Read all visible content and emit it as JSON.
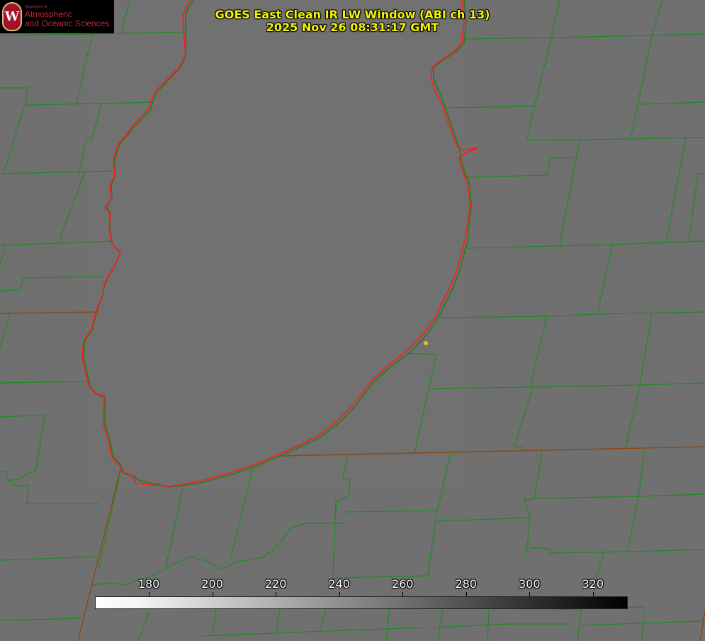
{
  "logo": {
    "department": "Department of",
    "line1": "Atmospheric",
    "line2": "and Oceanic Sciences",
    "seal_letter": "W"
  },
  "header": {
    "title_line1": "GOES East Clean IR LW Window (ABI ch 13)",
    "title_line2": "2025 Nov 26 08:31:17 GMT"
  },
  "colorbar": {
    "ticks": [
      "180",
      "200",
      "220",
      "240",
      "260",
      "280",
      "300",
      "320"
    ],
    "tick_values": [
      180,
      200,
      220,
      240,
      260,
      280,
      300,
      320
    ],
    "min_value": 163,
    "max_value": 331,
    "colors": {
      "low": "#ffffff",
      "high": "#000000"
    }
  },
  "map": {
    "county_line_color": "#1f8a1f",
    "state_line_color": "#8b4a1a",
    "lake_outline_color": "#ff2020",
    "marker_color": "#d6cc14",
    "background_color": "#6f6f6f"
  }
}
